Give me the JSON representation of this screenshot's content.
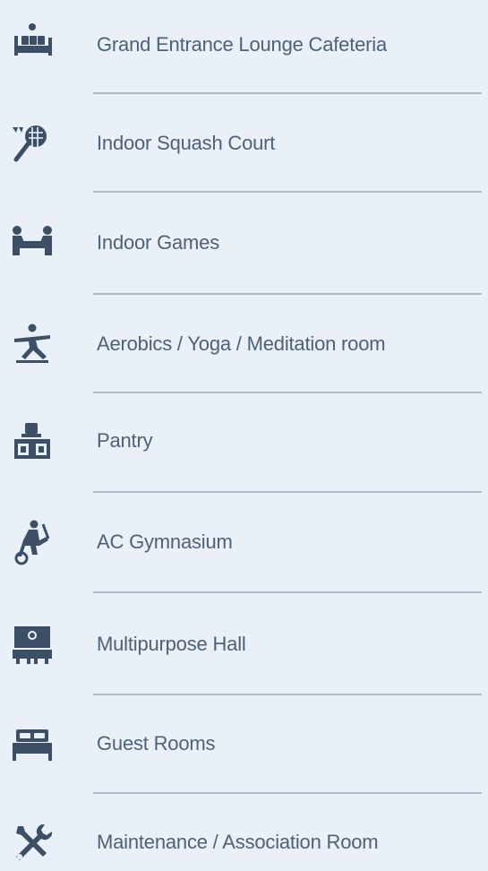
{
  "amenities": [
    {
      "label": "Grand Entrance Lounge Cafeteria",
      "icon": "lounge-icon"
    },
    {
      "label": "Indoor Squash Court",
      "icon": "squash-icon"
    },
    {
      "label": "Indoor Games",
      "icon": "indoor-games-icon"
    },
    {
      "label": "Aerobics / Yoga / Meditation room",
      "icon": "yoga-icon"
    },
    {
      "label": "Pantry",
      "icon": "pantry-icon"
    },
    {
      "label": "AC Gymnasium",
      "icon": "gym-icon"
    },
    {
      "label": "Multipurpose Hall",
      "icon": "multipurpose-hall-icon"
    },
    {
      "label": "Guest Rooms",
      "icon": "bed-icon"
    },
    {
      "label": "Maintenance / Association Room",
      "icon": "tools-icon"
    }
  ],
  "colors": {
    "background": "#e9f0f8",
    "text": "#4f6176",
    "icon": "#3d4f66",
    "divider": "#aebccc"
  }
}
